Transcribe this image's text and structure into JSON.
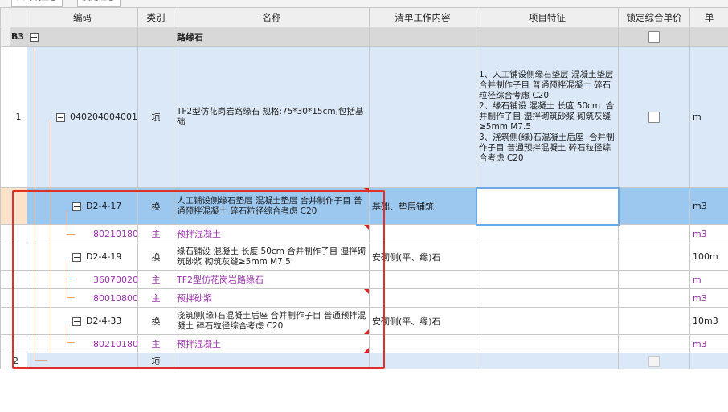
{
  "tabs": [
    "人材机汇总",
    "费用汇总"
  ],
  "columns": {
    "code": "编码",
    "category": "类别",
    "name": "名称",
    "work_content": "清单工作内容",
    "features": "项目特征",
    "lock_price": "锁定综合单价",
    "unit": "单"
  },
  "group": {
    "row_no": "B3",
    "name": "路缘石"
  },
  "item1": {
    "row_no": "1",
    "code": "040204004001",
    "category": "项",
    "name": "TF2型仿花岗岩路缘石 规格:75*30*15cm,包括基础",
    "features": "1、人工铺设侧缘石垫层 混凝土垫层  合并制作子目 普通预拌混凝土 碎石粒径综合考虑 C20\n2、缘石铺设 混凝土 长度 50cm  合并制作子目 湿拌砌筑砂浆 砌筑灰缝≥5mm M7.5\n3、浇筑侧(缘)石混凝土后座  合并制作子目 普通预拌混凝土 碎石粒径综合考虑 C20",
    "unit": "m"
  },
  "sub1": {
    "code": "D2-4-17",
    "category": "换",
    "name": "人工铺设侧缘石垫层 混凝土垫层  合并制作子目 普通预拌混凝土 碎石粒径综合考虑 C20",
    "work_content": "基础、垫层铺筑",
    "unit": "m3"
  },
  "mat1": {
    "code": "80210180",
    "category": "主",
    "name": "预拌混凝土",
    "unit": "m3"
  },
  "sub2": {
    "code": "D2-4-19",
    "category": "换",
    "name": "缘石铺设 混凝土 长度 50cm  合并制作子目 湿拌砌筑砂浆 砌筑灰缝≥5mm M7.5",
    "work_content": "安砌侧(平、缘)石",
    "unit": "100m"
  },
  "mat2": {
    "code": "36070020@1",
    "category": "主",
    "name": "TF2型仿花岗岩路缘石",
    "unit": "m"
  },
  "mat3": {
    "code": "80010800",
    "category": "主",
    "name": "预拌砂浆",
    "unit": "m3"
  },
  "sub3": {
    "code": "D2-4-33",
    "category": "换",
    "name": "浇筑侧(缘)石混凝土后座  合并制作子目 普通预拌混凝土 碎石粒径综合考虑 C20",
    "work_content": "安砌侧(平、缘)石",
    "unit": "10m3"
  },
  "mat4": {
    "code": "80210180",
    "category": "主",
    "name": "预拌混凝土",
    "unit": "m3"
  },
  "item2": {
    "row_no": "2",
    "category": "项"
  },
  "colors": {
    "highlight_box": "#e0302a",
    "selected_row": "#9cc8f0",
    "item_row": "#dbe8f7",
    "material_text": "#9933aa"
  }
}
